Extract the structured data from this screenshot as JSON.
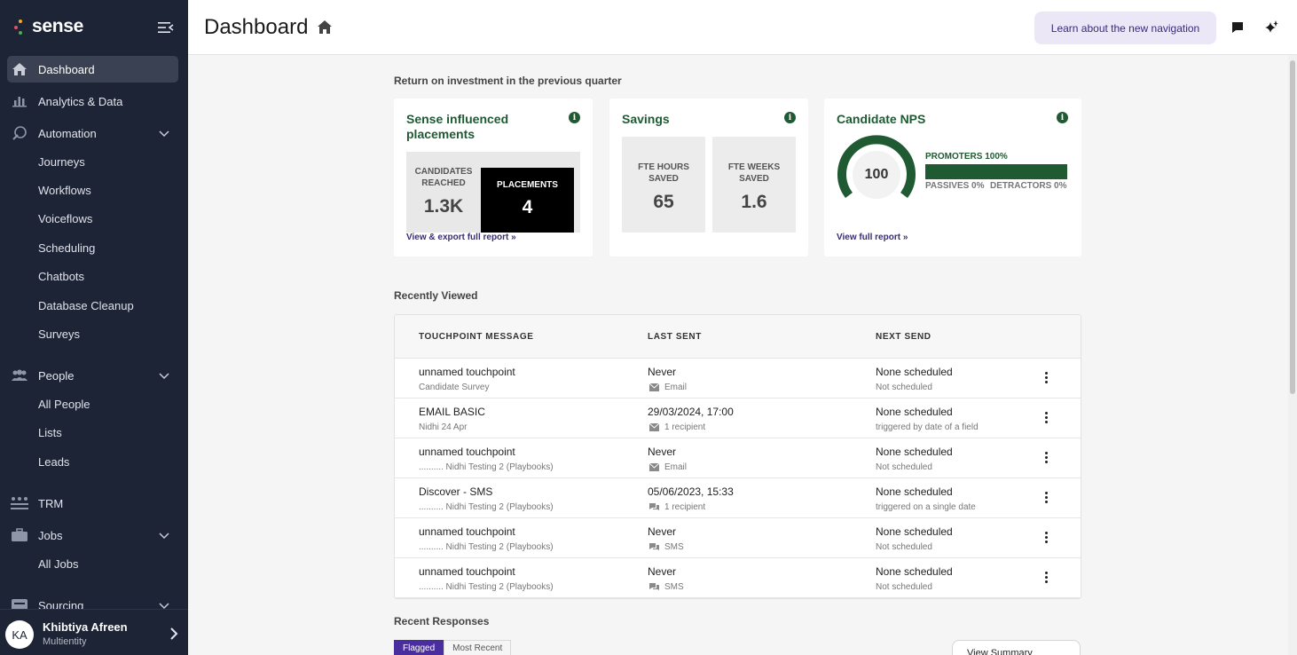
{
  "app": {
    "logo_text": "sense"
  },
  "sidebar": {
    "items": [
      {
        "label": "Dashboard"
      },
      {
        "label": "Analytics & Data"
      },
      {
        "label": "Automation"
      },
      {
        "label": "People"
      },
      {
        "label": "TRM"
      },
      {
        "label": "Jobs"
      },
      {
        "label": "Sourcing"
      }
    ],
    "automation_sub": [
      "Journeys",
      "Workflows",
      "Voiceflows",
      "Scheduling",
      "Chatbots",
      "Database Cleanup",
      "Surveys"
    ],
    "people_sub": [
      "All People",
      "Lists",
      "Leads"
    ],
    "jobs_sub": [
      "All Jobs"
    ]
  },
  "user": {
    "initials": "KA",
    "name": "Khibtiya Afreen",
    "org": "Multientity"
  },
  "header": {
    "title": "Dashboard",
    "learn_button": "Learn about the new navigation"
  },
  "roi": {
    "section_label": "Return on investment in the previous quarter",
    "placements_card": {
      "title": "Sense influenced placements",
      "candidates_label": "CANDIDATES REACHED",
      "candidates_value": "1.3K",
      "placements_label": "PLACEMENTS",
      "placements_value": "4",
      "link": "View & export full report »"
    },
    "savings_card": {
      "title": "Savings",
      "hours_label": "FTE HOURS SAVED",
      "hours_value": "65",
      "weeks_label": "FTE WEEKS SAVED",
      "weeks_value": "1.6"
    },
    "nps_card": {
      "title": "Candidate NPS",
      "score": "100",
      "score_fraction": 1.0,
      "promoters": "PROMOTERS 100%",
      "passives": "PASSIVES 0%",
      "detractors": "DETRACTORS 0%",
      "link": "View full report »"
    }
  },
  "recent": {
    "section_label": "Recently Viewed",
    "columns": [
      "TOUCHPOINT MESSAGE",
      "LAST SENT",
      "NEXT SEND"
    ],
    "rows": [
      {
        "name": "unnamed touchpoint",
        "sub": "Candidate Survey",
        "last": "Never",
        "last_sub": "Email",
        "next": "None scheduled",
        "next_sub": "Not scheduled"
      },
      {
        "name": "EMAIL BASIC",
        "sub": "Nidhi 24 Apr",
        "last": "29/03/2024, 17:00",
        "last_sub": "1 recipient",
        "next": "None scheduled",
        "next_sub": "triggered by date of a field"
      },
      {
        "name": "unnamed touchpoint",
        "sub": ".......... Nidhi Testing 2 (Playbooks)",
        "last": "Never",
        "last_sub": "Email",
        "next": "None scheduled",
        "next_sub": "Not scheduled"
      },
      {
        "name": "Discover - SMS",
        "sub": ".......... Nidhi Testing 2 (Playbooks)",
        "last": "05/06/2023, 15:33",
        "last_sub": "1 recipient",
        "next": "None scheduled",
        "next_sub": "triggered on a single date"
      },
      {
        "name": "unnamed touchpoint",
        "sub": ".......... Nidhi Testing 2 (Playbooks)",
        "last": "Never",
        "last_sub": "SMS",
        "next": "None scheduled",
        "next_sub": "Not scheduled"
      },
      {
        "name": "unnamed touchpoint",
        "sub": ".......... Nidhi Testing 2 (Playbooks)",
        "last": "Never",
        "last_sub": "SMS",
        "next": "None scheduled",
        "next_sub": "Not scheduled"
      }
    ]
  },
  "responses": {
    "section_label": "Recent Responses",
    "tab_flagged": "Flagged",
    "tab_recent": "Most Recent",
    "view_summary": "View Summary"
  },
  "icons": {
    "home": "home-icon",
    "analytics": "bar-chart-icon",
    "automation": "automation-icon",
    "people": "people-icon",
    "trm": "trm-icon",
    "jobs": "briefcase-icon",
    "sourcing": "sourcing-icon",
    "chat": "chat-icon",
    "sparkle": "sparkle-icon",
    "info": "info-icon",
    "email": "envelope-icon",
    "sms": "sms-icon"
  },
  "colors": {
    "sidebar_bg": "#1d2436",
    "brand_green": "#1f5a33",
    "accent_purple": "#4a2ea0",
    "learn_bg": "#ebe7f7"
  }
}
